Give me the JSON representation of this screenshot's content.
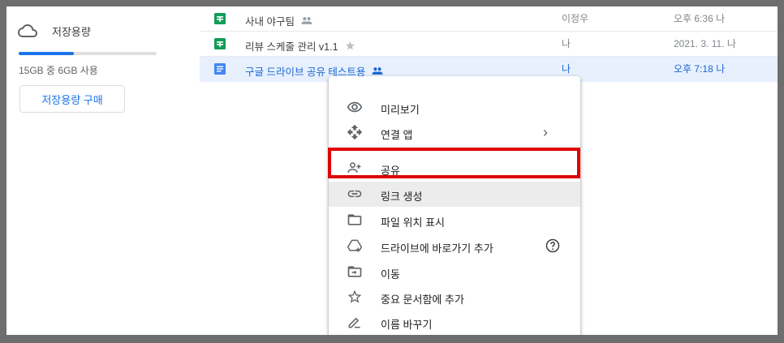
{
  "sidebar": {
    "storage_title": "저장용량",
    "storage_used_fraction": 0.4,
    "storage_usage_text": "15GB 중 6GB 사용",
    "buy_button": "저장용량 구매",
    "accent_color": "#1a73e8"
  },
  "files": [
    {
      "name": "사내 야구팀",
      "type": "sheets",
      "shared": true,
      "starred": false,
      "owner": "이정우",
      "modified": "오후 6:36 나",
      "selected": false
    },
    {
      "name": "리뷰 스케줄 관리 v1.1",
      "type": "sheets",
      "shared": false,
      "starred": true,
      "owner": "나",
      "modified": "2021. 3. 11. 나",
      "selected": false
    },
    {
      "name": "구글 드라이브 공유 테스트용",
      "type": "docs",
      "shared": true,
      "starred": false,
      "owner": "나",
      "modified": "오후 7:18 나",
      "selected": true
    }
  ],
  "menu": {
    "items": [
      {
        "label": "미리보기",
        "icon": "eye-icon"
      },
      {
        "label": "연결 앱",
        "icon": "move-arrows-icon",
        "submenu": true
      },
      {
        "label": "공유",
        "icon": "person-add-icon",
        "highlighted": true
      },
      {
        "label": "링크 생성",
        "icon": "link-icon",
        "hover": true
      },
      {
        "label": "파일 위치 표시",
        "icon": "folder-icon"
      },
      {
        "label": "드라이브에 바로가기 추가",
        "icon": "drive-shortcut-icon",
        "help": true
      },
      {
        "label": "이동",
        "icon": "move-to-folder-icon"
      },
      {
        "label": "중요 문서함에 추가",
        "icon": "star-icon"
      },
      {
        "label": "이름 바꾸기",
        "icon": "pencil-icon"
      }
    ],
    "submenu_glyph": "›",
    "highlight_color": "#e00000"
  }
}
